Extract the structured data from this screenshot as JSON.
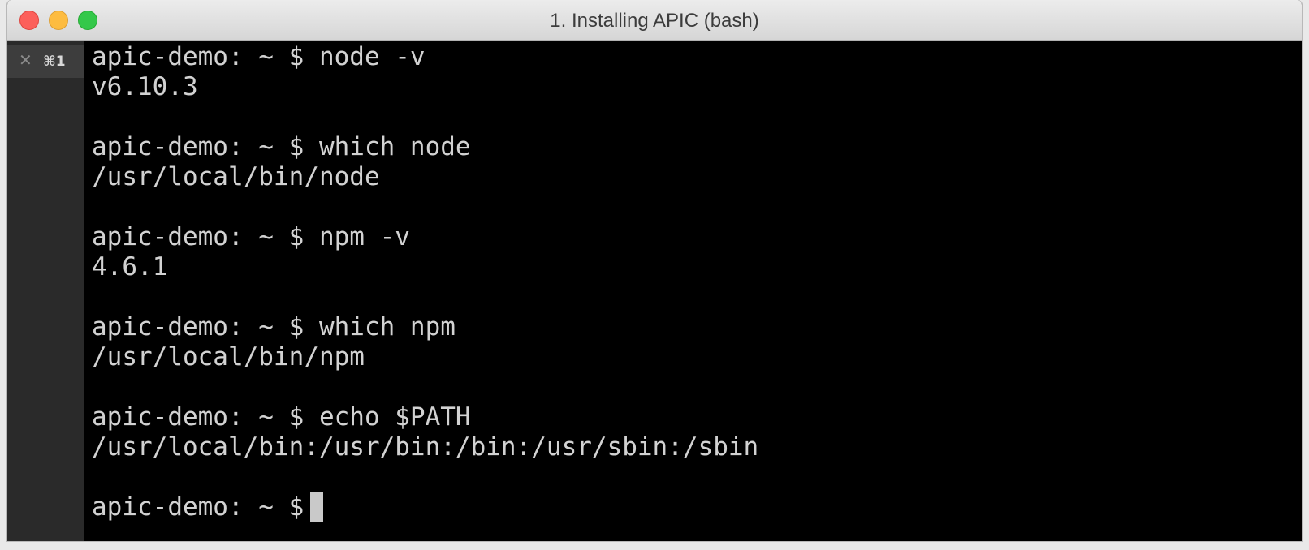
{
  "window": {
    "title": "1. Installing APIC (bash)"
  },
  "tab": {
    "close_glyph": "✕",
    "shortcut": "⌘1"
  },
  "terminal": {
    "lines": [
      "apic-demo: ~ $ node -v",
      "v6.10.3",
      "",
      "apic-demo: ~ $ which node",
      "/usr/local/bin/node",
      "",
      "apic-demo: ~ $ npm -v",
      "4.6.1",
      "",
      "apic-demo: ~ $ which npm",
      "/usr/local/bin/npm",
      "",
      "apic-demo: ~ $ echo $PATH",
      "/usr/local/bin:/usr/bin:/bin:/usr/sbin:/sbin",
      "",
      "apic-demo: ~ $"
    ]
  },
  "colors": {
    "close": "#fc605b",
    "minimize": "#fdbc40",
    "zoom": "#34c84a",
    "terminal_bg": "#000000",
    "terminal_fg": "#d2d2d2"
  }
}
